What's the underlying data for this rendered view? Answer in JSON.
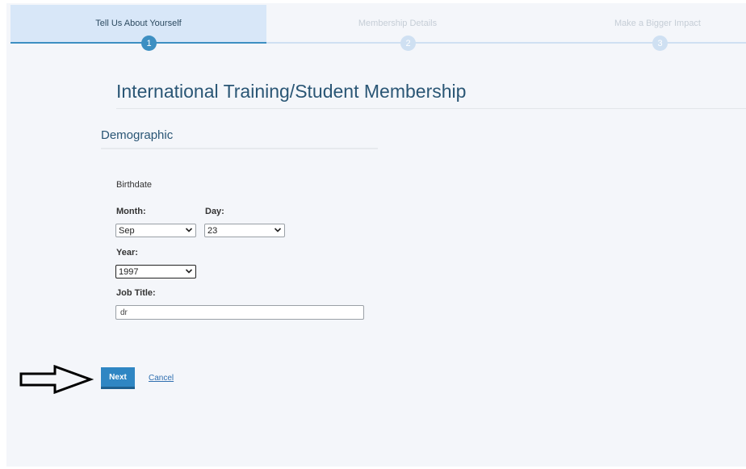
{
  "stepper": {
    "steps": [
      {
        "label": "Tell Us About Yourself",
        "number": "1",
        "state": "active"
      },
      {
        "label": "Membership Details",
        "number": "2",
        "state": "inactive"
      },
      {
        "label": "Make a Bigger Impact",
        "number": "3",
        "state": "inactive"
      }
    ]
  },
  "page": {
    "title": "International Training/Student Membership"
  },
  "section": {
    "title": "Demographic"
  },
  "form": {
    "birthdate_label": "Birthdate",
    "month_label": "Month:",
    "month_value": "Sep",
    "day_label": "Day:",
    "day_value": "23",
    "year_label": "Year:",
    "year_value": "1997",
    "job_title_label": "Job Title:",
    "job_title_value": "dr"
  },
  "actions": {
    "next_label": "Next",
    "cancel_label": "Cancel"
  },
  "colors": {
    "accent": "#2f86c3",
    "title": "#2a5675",
    "active_tab": "#d8e7f8"
  }
}
